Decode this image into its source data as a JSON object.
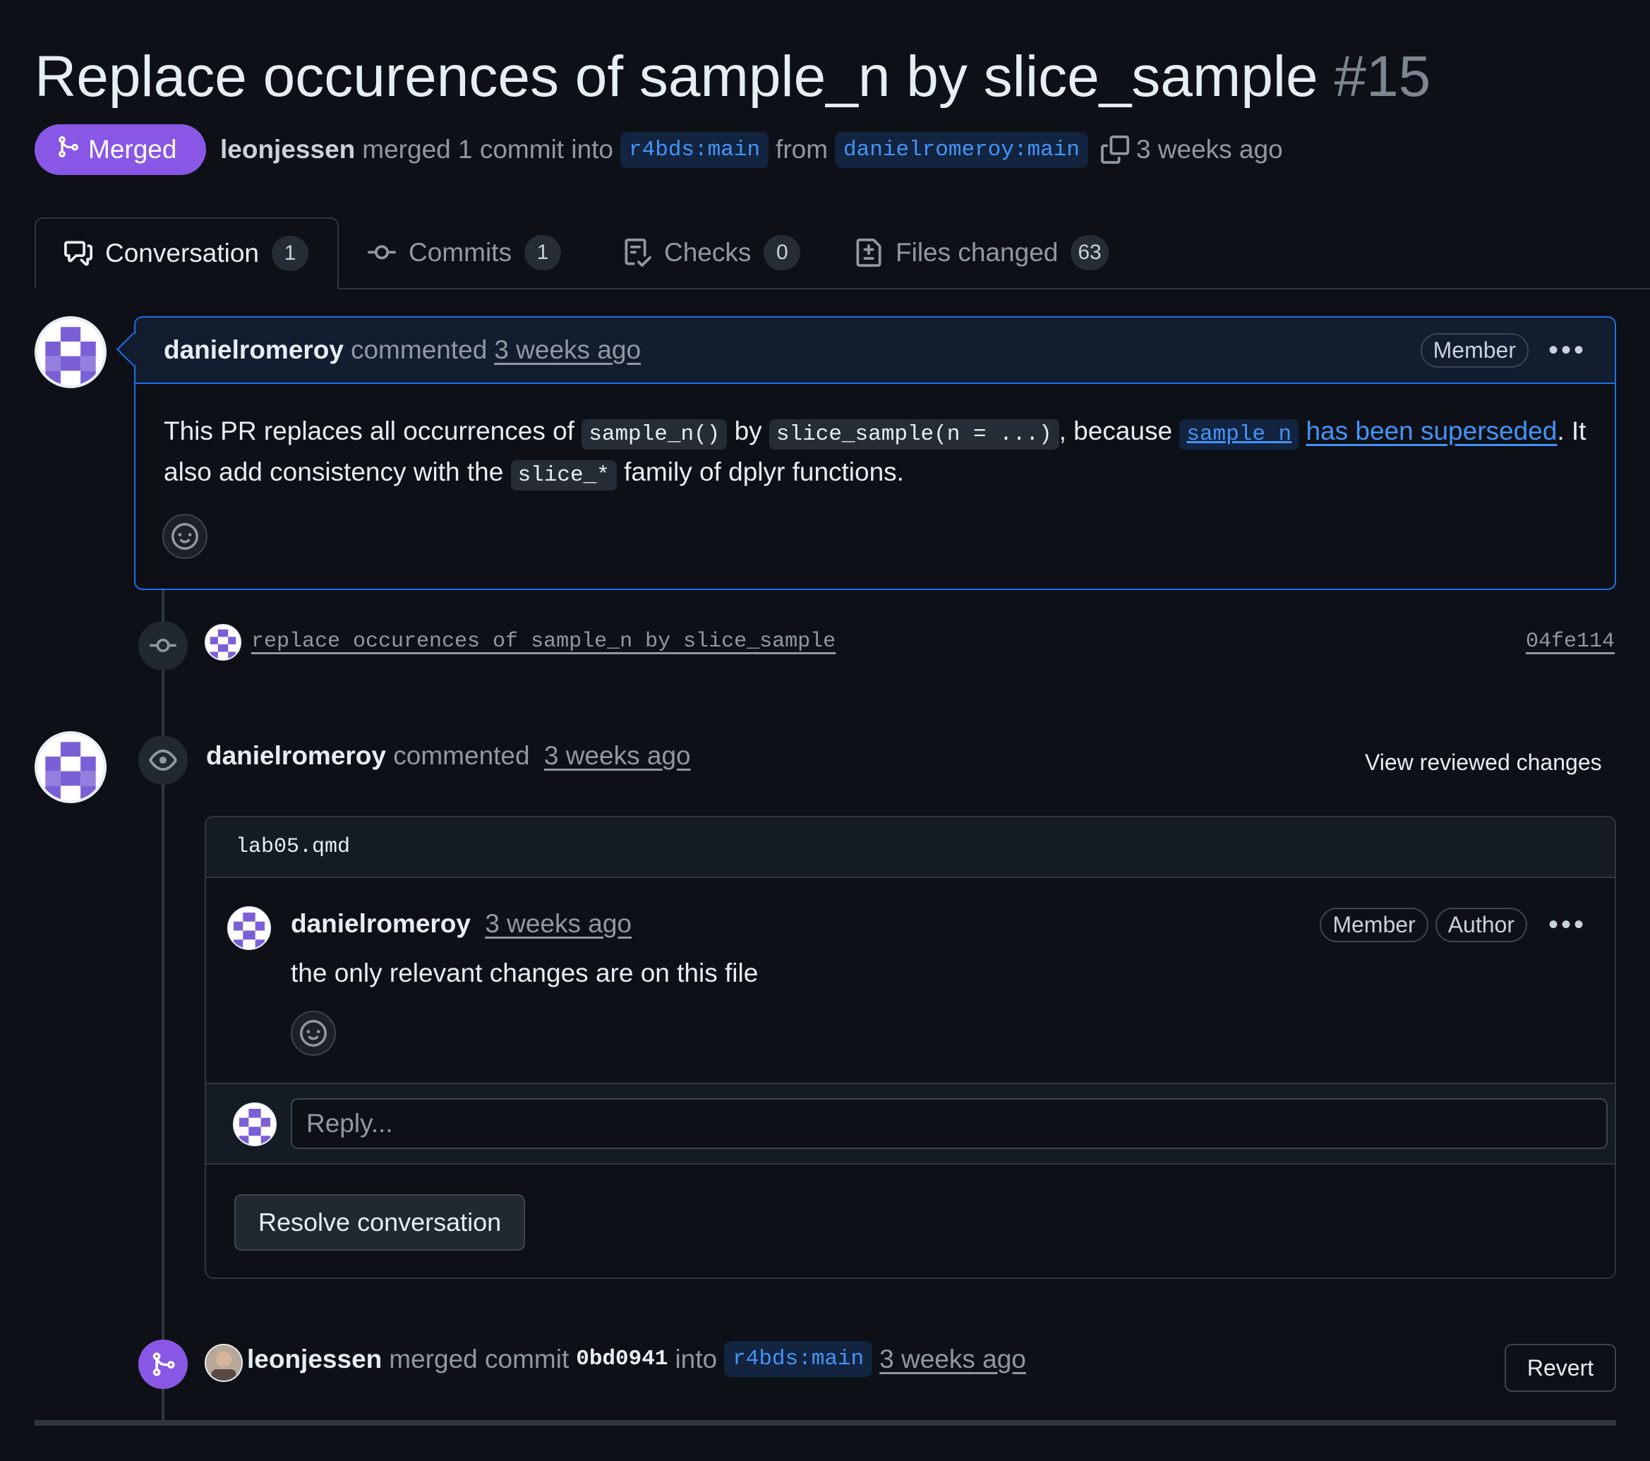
{
  "pr": {
    "title": "Replace occurences of sample_n by slice_sample",
    "number": "#15",
    "state_label": "Merged",
    "merged_by": "leonjessen",
    "merged_text": "merged 1 commit into",
    "base_branch": "r4bds:main",
    "from_text": "from",
    "head_branch": "danielromeroy:main",
    "time": "3 weeks ago"
  },
  "tabs": [
    {
      "label": "Conversation",
      "count": "1",
      "icon": "comment-discussion-icon"
    },
    {
      "label": "Commits",
      "count": "1",
      "icon": "git-commit-icon"
    },
    {
      "label": "Checks",
      "count": "0",
      "icon": "checklist-icon"
    },
    {
      "label": "Files changed",
      "count": "63",
      "icon": "file-diff-icon"
    }
  ],
  "comment1": {
    "author": "danielromeroy",
    "action": "commented",
    "time": "3 weeks ago",
    "role": "Member",
    "body_p1": "This PR replaces all occurrences of",
    "code1": "sample_n()",
    "body_p2": "by",
    "code2": "slice_sample(n = ...)",
    "body_p3": ", because",
    "code_link": "sample_n",
    "link_text": "has been superseded",
    "body_p4": ". It also add consistency with the",
    "code3": "slice_*",
    "body_p5": "family of dplyr functions."
  },
  "commit": {
    "message": "replace occurences of sample_n by slice_sample",
    "sha": "04fe114"
  },
  "review": {
    "author": "danielromeroy",
    "action": "commented",
    "time": "3 weeks ago",
    "view_changes": "View reviewed changes",
    "file": "lab05.qmd",
    "inner_author": "danielromeroy",
    "inner_time": "3 weeks ago",
    "badge_member": "Member",
    "badge_author": "Author",
    "inner_body": "the only relevant changes are on this file",
    "reply_placeholder": "Reply...",
    "resolve": "Resolve conversation"
  },
  "merge_event": {
    "author": "leonjessen",
    "text1": "merged commit",
    "sha": "0bd0941",
    "text2": "into",
    "branch": "r4bds:main",
    "time": "3 weeks ago",
    "revert": "Revert"
  },
  "colors": {
    "merged_purple": "#8957e5",
    "link_blue": "#4493f8",
    "background": "#0d1117",
    "avatar_purple": "#7b5fd6"
  }
}
